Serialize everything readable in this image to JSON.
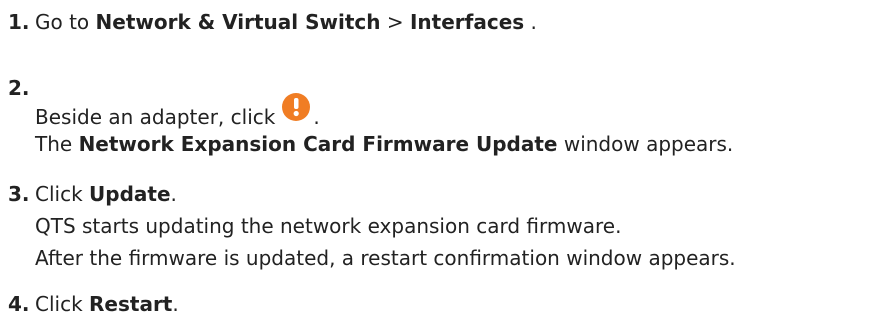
{
  "steps": [
    {
      "number": "1.",
      "parts": {
        "prefix": "Go to ",
        "bold1": "Network & Virtual Switch",
        "separator": " > ",
        "bold2": "Interfaces",
        "suffix": " ."
      }
    },
    {
      "number": "2.",
      "line1": {
        "prefix": "Beside an adapter, click",
        "suffix": "."
      },
      "line2": {
        "prefix": "The ",
        "bold": "Network Expansion Card Firmware Update",
        "suffix": " window appears."
      }
    },
    {
      "number": "3.",
      "line1": {
        "prefix": "Click ",
        "bold": "Update",
        "suffix": "."
      },
      "line2": "QTS starts updating the network expansion card firmware.",
      "line3": "After the firmware is updated, a restart confirmation window appears."
    },
    {
      "number": "4.",
      "line1": {
        "prefix": "Click ",
        "bold": "Restart",
        "suffix": "."
      }
    }
  ],
  "icons": {
    "warning": "warning-icon",
    "warning_color": "#f07d24"
  }
}
